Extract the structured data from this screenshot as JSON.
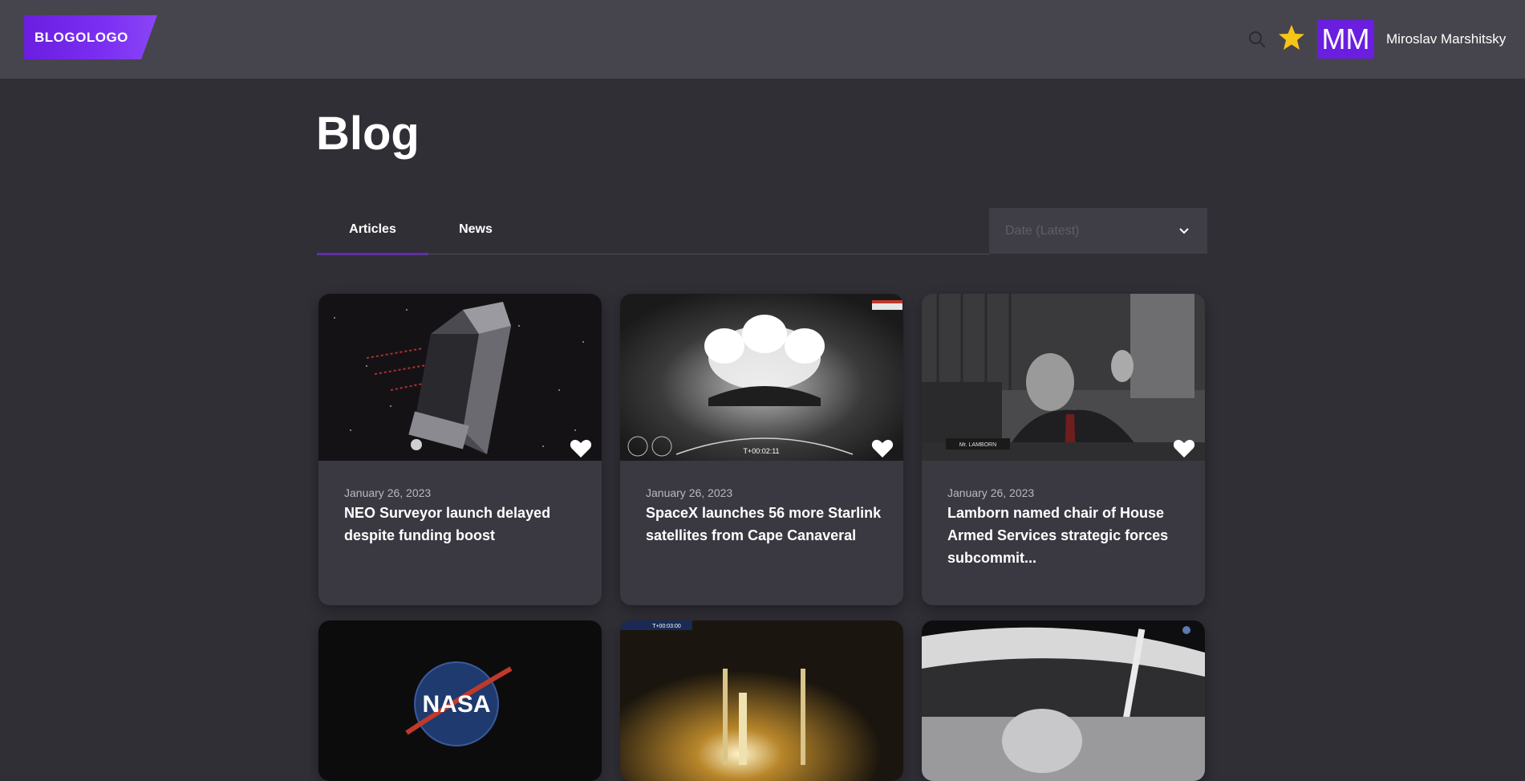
{
  "header": {
    "logo_text": "BLOGOLOGO",
    "avatar_initials": "MM",
    "user_name": "Miroslav Marshitsky"
  },
  "page": {
    "title": "Blog"
  },
  "tabs": [
    {
      "label": "Articles",
      "active": true
    },
    {
      "label": "News",
      "active": false
    }
  ],
  "sort": {
    "placeholder": "Date (Latest)"
  },
  "colors": {
    "accent": "#6a1ee0",
    "background": "#302f36",
    "header": "#46454d",
    "card": "#3a3941",
    "star": "#f7c518"
  },
  "cards": [
    {
      "date": "January 26, 2023",
      "title": "NEO Surveyor launch delayed despite funding boost",
      "image": "space-telescope"
    },
    {
      "date": "January 26, 2023",
      "title": "SpaceX launches 56 more Starlink satellites from Cape Canaveral",
      "image": "rocket-launch-bw",
      "overlay_text": "T+00:02:11"
    },
    {
      "date": "January 26, 2023",
      "title": "Lamborn named chair of House Armed Services strategic forces subcommit...",
      "image": "hearing-photo",
      "overlay_text": "Mr. LAMBORN"
    },
    {
      "date": "",
      "title": "",
      "image": "nasa-logo",
      "overlay_text": "NASA"
    },
    {
      "date": "",
      "title": "",
      "image": "night-launch",
      "overlay_text": "T+00:03:00"
    },
    {
      "date": "",
      "title": "",
      "image": "spacewalk"
    }
  ]
}
